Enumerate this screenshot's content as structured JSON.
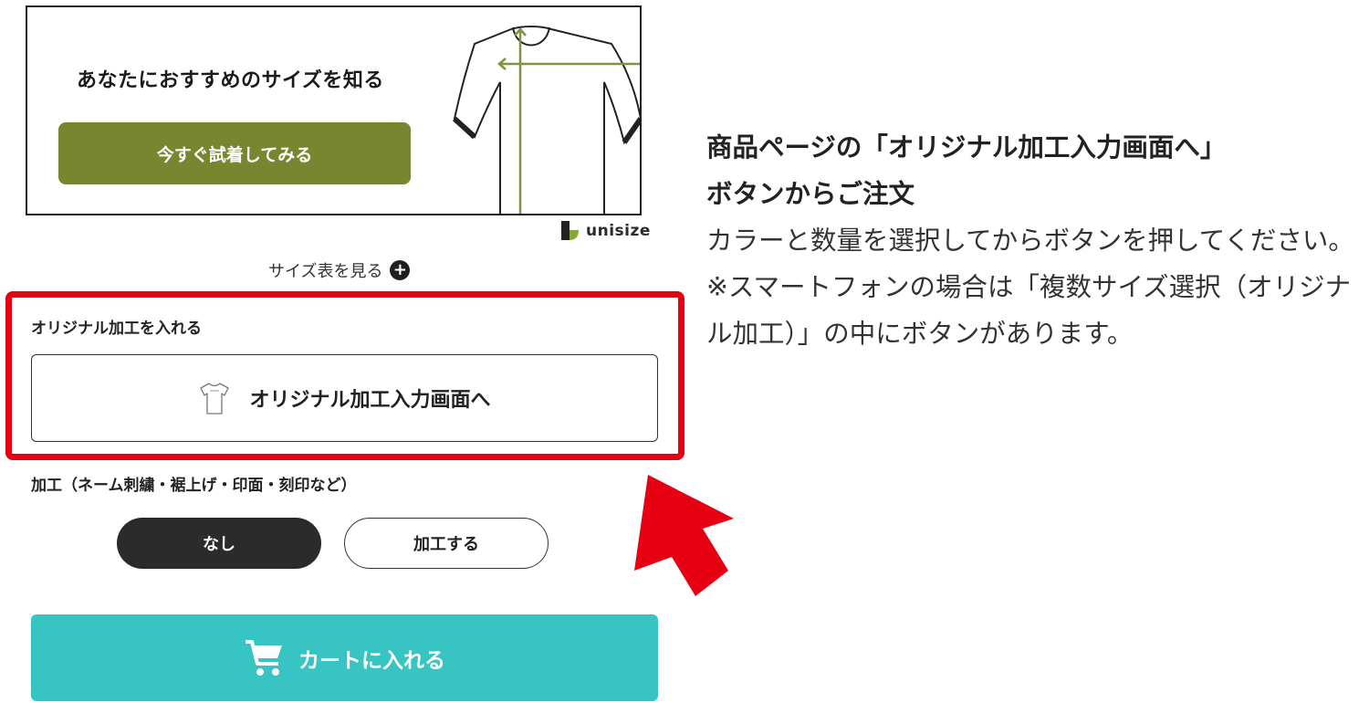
{
  "banner": {
    "heading": "あなたにおすすめのサイズを知る",
    "tryon_button": "今すぐ試着してみる"
  },
  "unisize": {
    "brand": "unisize"
  },
  "size_chart": {
    "label": "サイズ表を見る"
  },
  "custom_processing": {
    "section_label": "オリジナル加工を入れる",
    "entry_button": "オリジナル加工入力画面へ"
  },
  "processing_options": {
    "label": "加工（ネーム刺繍・裾上げ・印面・刻印など）",
    "none": "なし",
    "process": "加工する",
    "selected": "なし"
  },
  "cart": {
    "button_label": "カートに入れる"
  },
  "instructions": {
    "title_line1": "商品ページの「オリジナル加工入力画面へ」",
    "title_line2": "ボタンからご注文",
    "body": "カラーと数量を選択してからボタンを押してください。",
    "note": "※スマートフォンの場合は「複数サイズ選択（オリジナル加工）」の中にボタンがあります。"
  },
  "colors": {
    "olive": "#78862f",
    "teal": "#39c4c4",
    "highlight_red": "#e60012",
    "dark": "#2b2b2b"
  },
  "icons": {
    "plus": "plus-circle-icon",
    "tshirt": "tshirt-icon",
    "cart": "cart-icon",
    "arrow": "red-arrow-icon"
  }
}
